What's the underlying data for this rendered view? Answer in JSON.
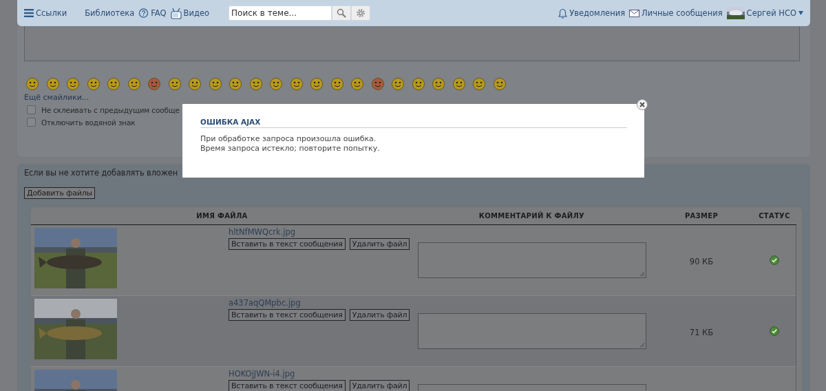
{
  "navbar": {
    "links": [
      "Ссылки",
      "Библиотека",
      "FAQ",
      "Видео"
    ],
    "search": {
      "placeholder": "Поиск в теме..."
    },
    "right": [
      "Уведомления",
      "Личные сообщения"
    ],
    "user": {
      "name": "Сергей НСО"
    }
  },
  "editor": {
    "more_smileys": "Ещё смайлики...",
    "options": [
      {
        "label": "Не склеивать с предыдущим сообще",
        "checked": false
      },
      {
        "label": "Отключить водяной знак",
        "checked": false
      }
    ]
  },
  "attachments": {
    "note": "Если вы не хотите добавлять вложен",
    "add_button": "Добавить файлы",
    "columns": [
      "ИМЯ ФАЙЛА",
      "КОММЕНТАРИЙ К ФАЙЛУ",
      "РАЗМЕР",
      "СТАТУС"
    ],
    "rows": [
      {
        "filename": "hltNfMWQcrk.jpg",
        "insert_label": "Вставить в текст сообщения",
        "delete_label": "Удалить файл",
        "size": "90 КБ",
        "uploaded": true
      },
      {
        "filename": "a437aqQMpbc.jpg",
        "insert_label": "Вставить в текст сообщения",
        "delete_label": "Удалить файл",
        "size": "71 КБ",
        "uploaded": true
      },
      {
        "filename": "HOKOjJWN-i4.jpg",
        "insert_label": "Вставить в текст сообщения",
        "delete_label": "Удалить файл"
      }
    ]
  },
  "dialog": {
    "title": "ОШИБКА AJAX",
    "lines": [
      "При обработке запроса произошла ошибка.",
      "Время запроса истекло; повторите попытку."
    ]
  }
}
